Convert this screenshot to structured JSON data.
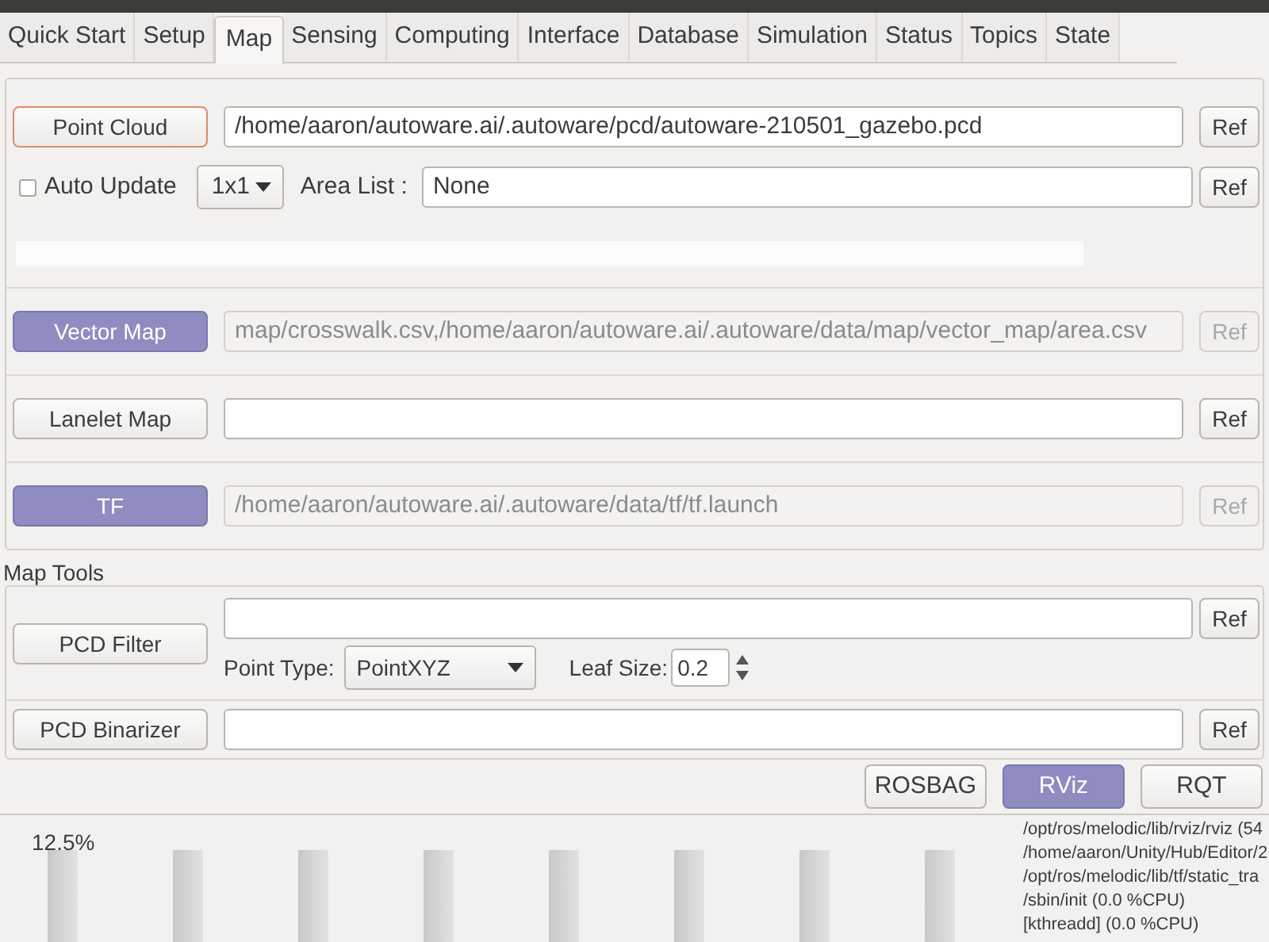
{
  "tabs": [
    {
      "label": "Quick Start",
      "selected": false
    },
    {
      "label": "Setup",
      "selected": false
    },
    {
      "label": "Map",
      "selected": true
    },
    {
      "label": "Sensing",
      "selected": false
    },
    {
      "label": "Computing",
      "selected": false
    },
    {
      "label": "Interface",
      "selected": false
    },
    {
      "label": "Database",
      "selected": false
    },
    {
      "label": "Simulation",
      "selected": false
    },
    {
      "label": "Status",
      "selected": false
    },
    {
      "label": "Topics",
      "selected": false
    },
    {
      "label": "State",
      "selected": false
    }
  ],
  "point_cloud": {
    "button": "Point Cloud",
    "focused": true,
    "path": "/home/aaron/autoware.ai/.autoware/pcd/autoware-210501_gazebo.pcd",
    "ref": "Ref",
    "auto_update": {
      "label": "Auto Update",
      "checked": false
    },
    "grid": "1x1",
    "area_list_label": "Area List :",
    "area_list": "None",
    "area_ref": "Ref",
    "progress": {
      "level": 0
    }
  },
  "maps": [
    {
      "button": "Vector Map",
      "active": true,
      "path": "map/crosswalk.csv,/home/aaron/autoware.ai/.autoware/data/map/vector_map/area.csv",
      "ref": "Ref"
    },
    {
      "button": "Lanelet Map",
      "active": false,
      "ref": "Ref"
    },
    {
      "button": "TF",
      "active": true,
      "path": "/home/aaron/autoware.ai/.autoware/data/tf/tf.launch",
      "ref": "Ref"
    }
  ],
  "map_tools": {
    "title": "Map Tools",
    "pcd_filter": {
      "button": "PCD Filter",
      "ref": "Ref",
      "point_type_label": "Point Type:",
      "point_type": "PointXYZ",
      "leaf_size_label": "Leaf Size:",
      "leaf_size": "0.2"
    },
    "pcd_binarizer": {
      "button": "PCD Binarizer",
      "ref": "Ref"
    }
  },
  "launch_buttons": [
    {
      "label": "ROSBAG",
      "active": false
    },
    {
      "label": "RViz",
      "active": true
    },
    {
      "label": "RQT",
      "active": false
    }
  ],
  "cpu": {
    "reading": "12.5%",
    "processes": [
      "/opt/ros/melodic/lib/rviz/rviz (54",
      "/home/aaron/Unity/Hub/Editor/2",
      "/opt/ros/melodic/lib/tf/static_tra",
      "/sbin/init (0.0 %CPU)",
      "[kthreadd] (0.0 %CPU)"
    ]
  }
}
